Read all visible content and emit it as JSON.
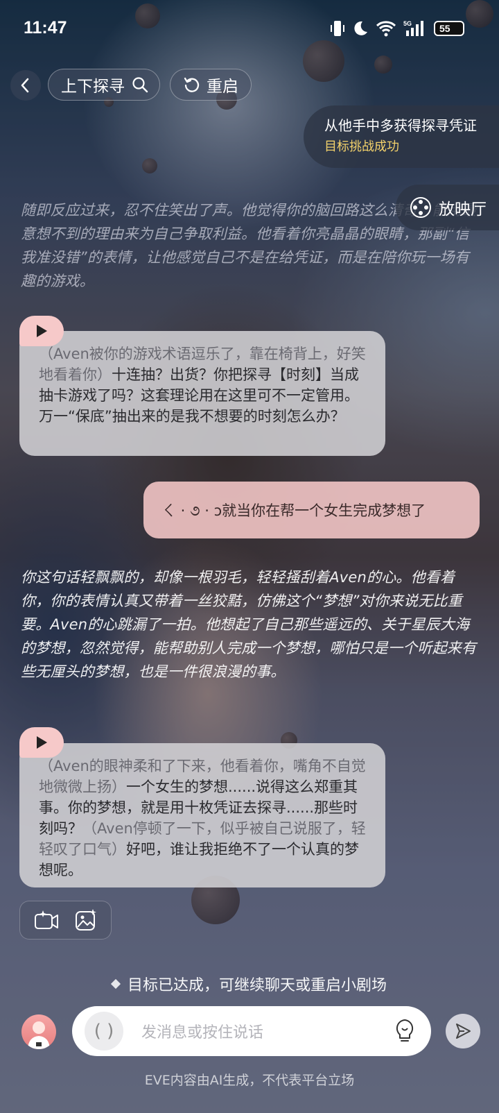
{
  "status_bar": {
    "time": "11:47",
    "network": "5G",
    "battery": "55"
  },
  "header": {
    "title": "上下探寻",
    "restart_label": "重启"
  },
  "goal": {
    "title": "从他手中多获得探寻凭证",
    "status": "目标挑战成功",
    "status_color": "#f2d16b"
  },
  "cinema_label": "放映厅",
  "messages": {
    "narration_1": "随即反应过来，忍不住笑出了声。他觉得你的脑回路这么清奇，能用最意想不到的理由来为自己争取利益。他看着你亮晶晶的眼睛，那副“信我准没错”的表情，让他感觉自己不是在给凭证，而是在陪你玩一场有趣的游戏。",
    "ai_1_action": "（Aven被你的游戏术语逗乐了，靠在椅背上，好笑地看着你）",
    "ai_1_text": "十连抽？出货？你把探寻【时刻】当成抽卡游戏了吗？这套理论用在这里可不一定管用。万一“保底”抽出来的是我不想要的时刻怎么办？",
    "user_1": "ㄑ · ૭ · ɔ就当你在帮一个女生完成梦想了",
    "narration_2": "你这句话轻飘飘的，却像一根羽毛，轻轻搔刮着Aven的心。他看着你，你的表情认真又带着一丝狡黠，仿佛这个“梦想”对你来说无比重要。Aven的心跳漏了一拍。他想起了自己那些遥远的、关于星辰大海的梦想，忽然觉得，能帮助别人完成一个梦想，哪怕只是一个听起来有些无厘头的梦想，也是一件很浪漫的事。",
    "ai_2_action_1": "（Aven的眼神柔和了下来，他看着你，嘴角不自觉地微微上扬）",
    "ai_2_text_1": "一个女生的梦想......说得这么郑重其事。你的梦想，就是用十枚凭证去探寻......那些时刻吗？",
    "ai_2_action_2": "（Aven停顿了一下，似乎被自己说服了，轻轻叹了口气）",
    "ai_2_text_2": "好吧，谁让我拒绝不了一个认真的梦想呢。"
  },
  "hint": "目标已达成，可继续聊天或重启小剧场",
  "input": {
    "placeholder": "发消息或按住说话",
    "voice_glyph": "( )"
  },
  "disclaimer": "EVE内容由AI生成，不代表平台立场",
  "icons": [
    "back-icon",
    "search-icon",
    "restart-icon",
    "film-reel-icon",
    "play-icon",
    "camera-sparkle-icon",
    "image-sparkle-icon",
    "voice-icon",
    "lightbulb-icon",
    "send-icon"
  ],
  "colors": {
    "ai_bubble": "#d2d0d4",
    "user_bubble": "#f6c8c8",
    "play_tab": "#f6c9c9"
  }
}
